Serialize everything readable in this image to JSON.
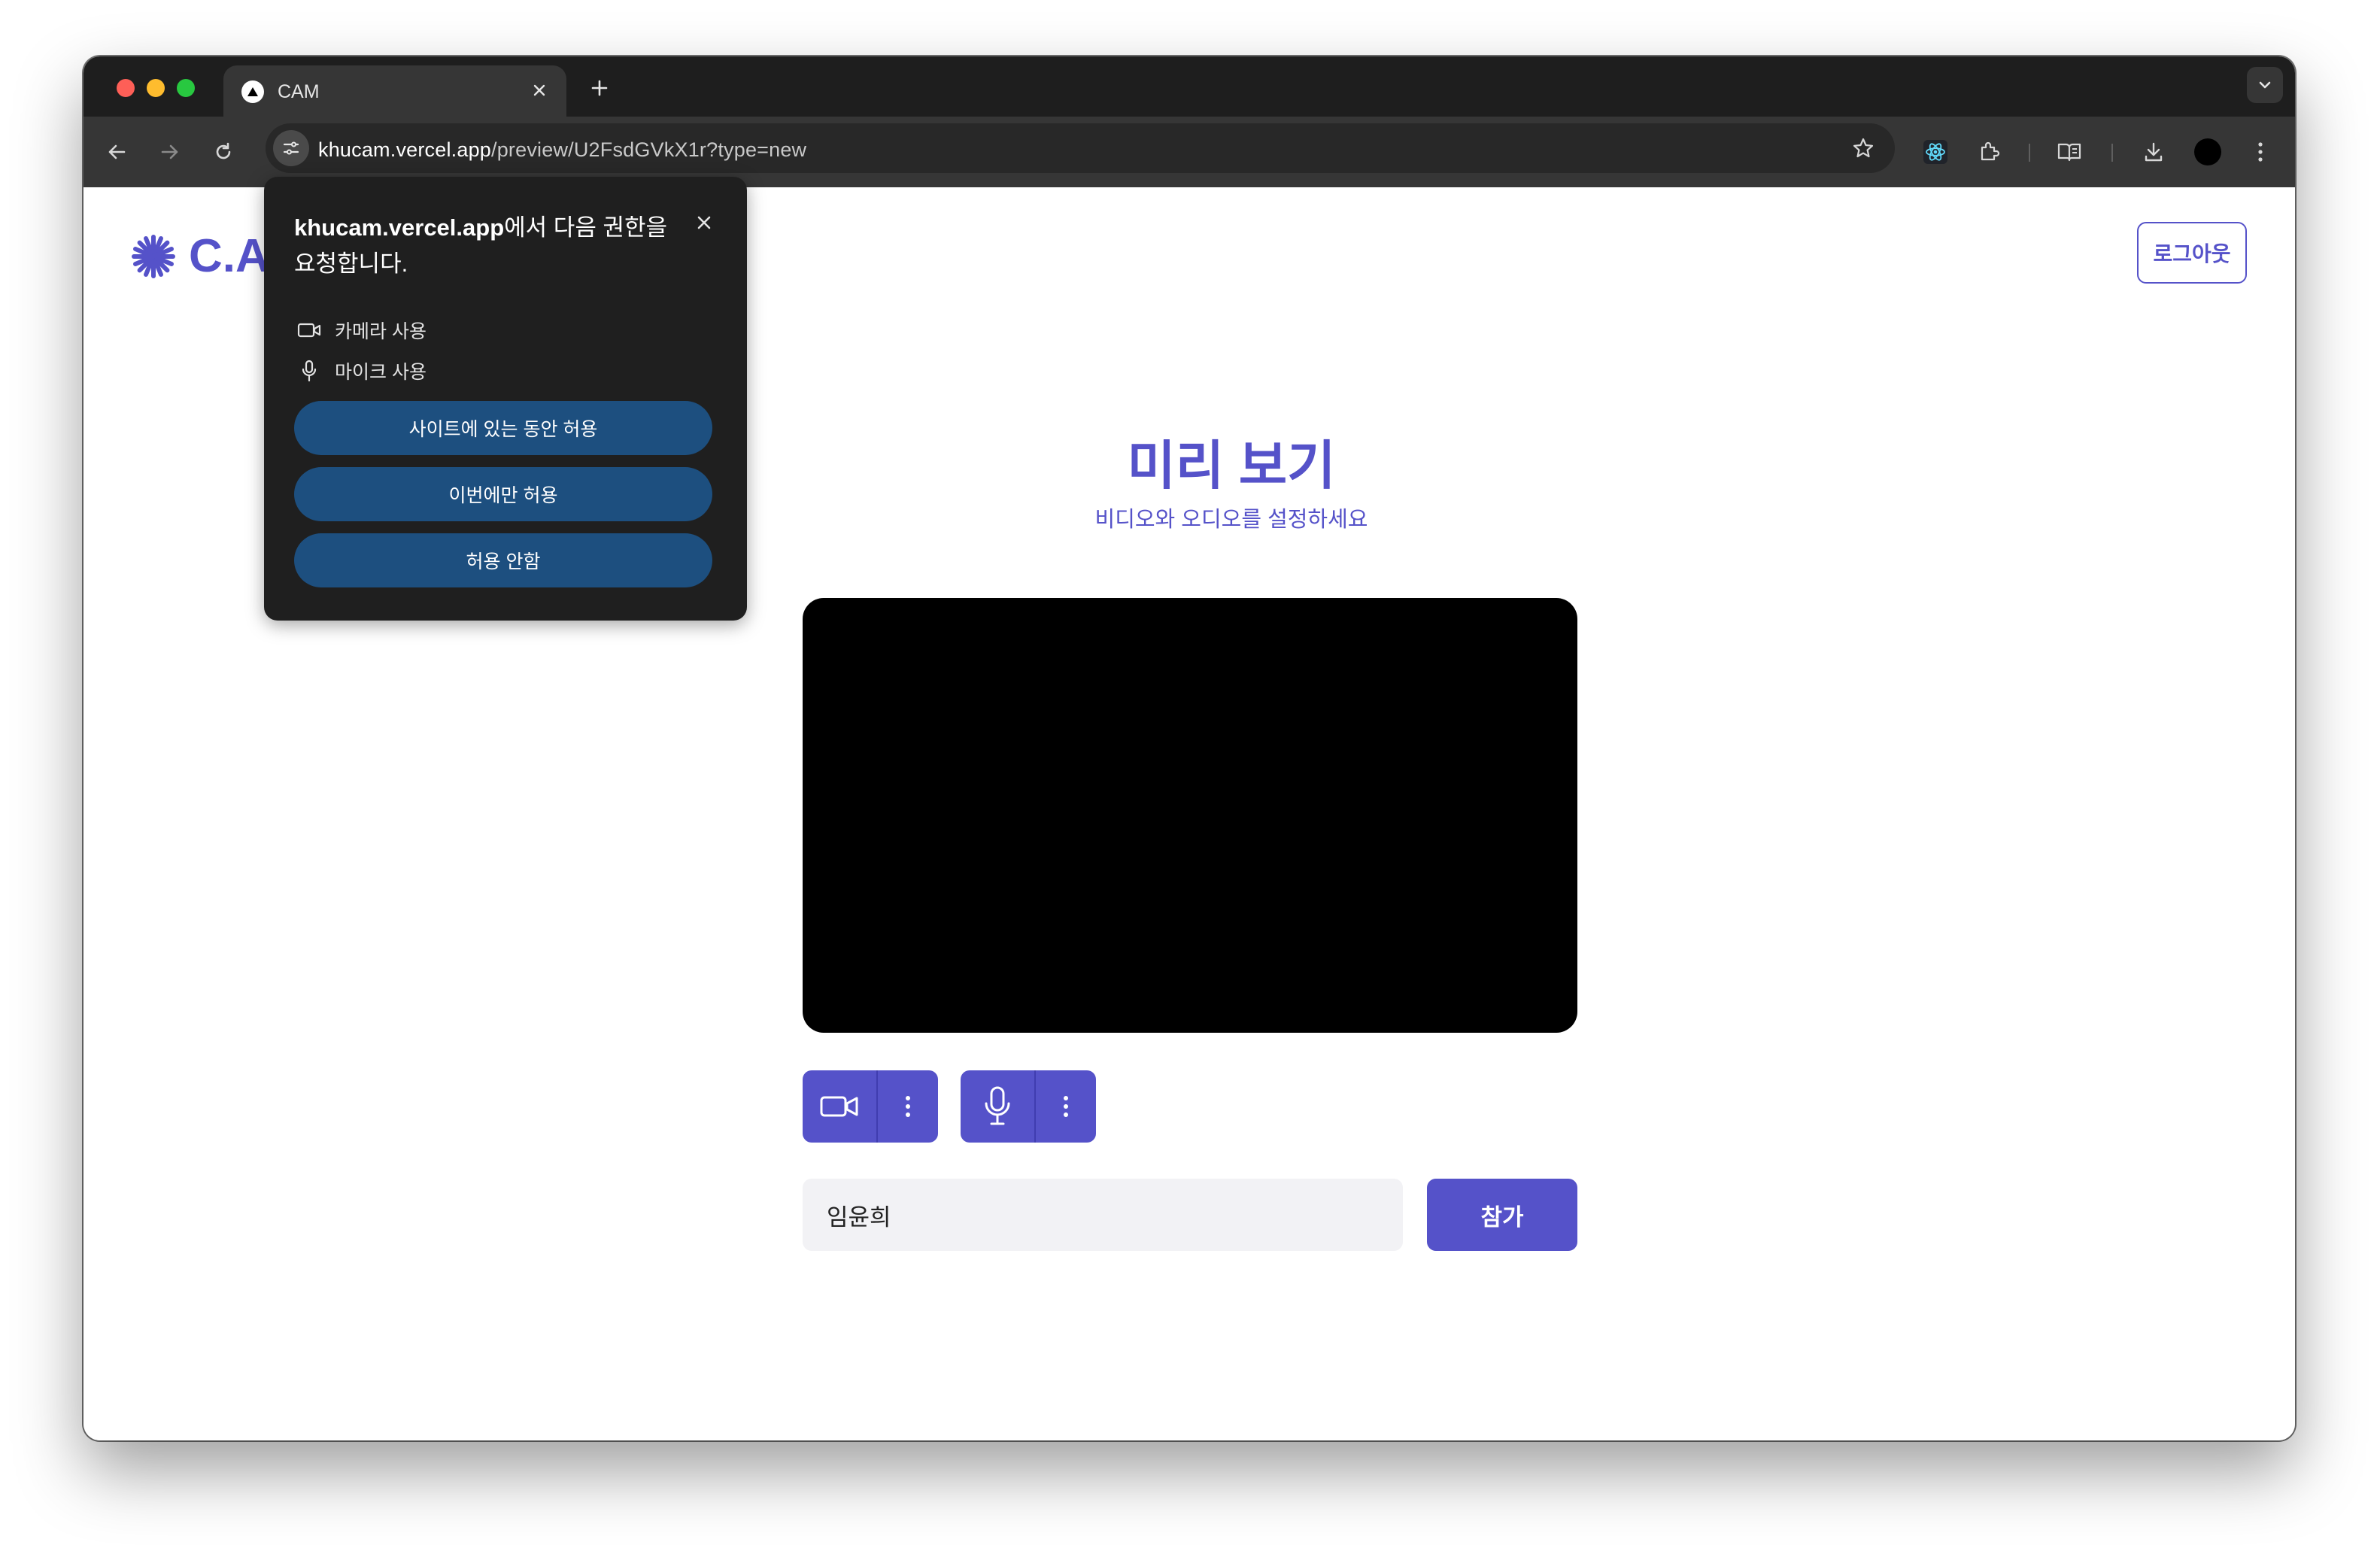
{
  "browser": {
    "tab": {
      "title": "CAM"
    },
    "url": {
      "host": "khucam.vercel.app",
      "path": "/preview/U2FsdGVkX1r?type=new"
    }
  },
  "page": {
    "logo_text": "C.A",
    "logout_label": "로그아웃",
    "title": "미리 보기",
    "subtitle": "비디오와 오디오를 설정하세요",
    "name_input": {
      "value": "임윤희"
    },
    "join_label": "참가"
  },
  "permission_popup": {
    "host": "khucam.vercel.app",
    "title_suffix": "에서 다음 권한을 요청합니다.",
    "items": [
      {
        "icon": "camera-icon",
        "label": "카메라 사용"
      },
      {
        "icon": "microphone-icon",
        "label": "마이크 사용"
      }
    ],
    "buttons": {
      "allow_while_visiting": "사이트에 있는 동안 허용",
      "allow_this_time": "이번에만 허용",
      "never_allow": "허용 안함"
    }
  },
  "colors": {
    "accent": "#5552c9",
    "popup_bg": "#1f1f1f",
    "popup_button": "#1d4f7f",
    "browser_frame": "#1e1e1e",
    "toolbar": "#363636"
  }
}
